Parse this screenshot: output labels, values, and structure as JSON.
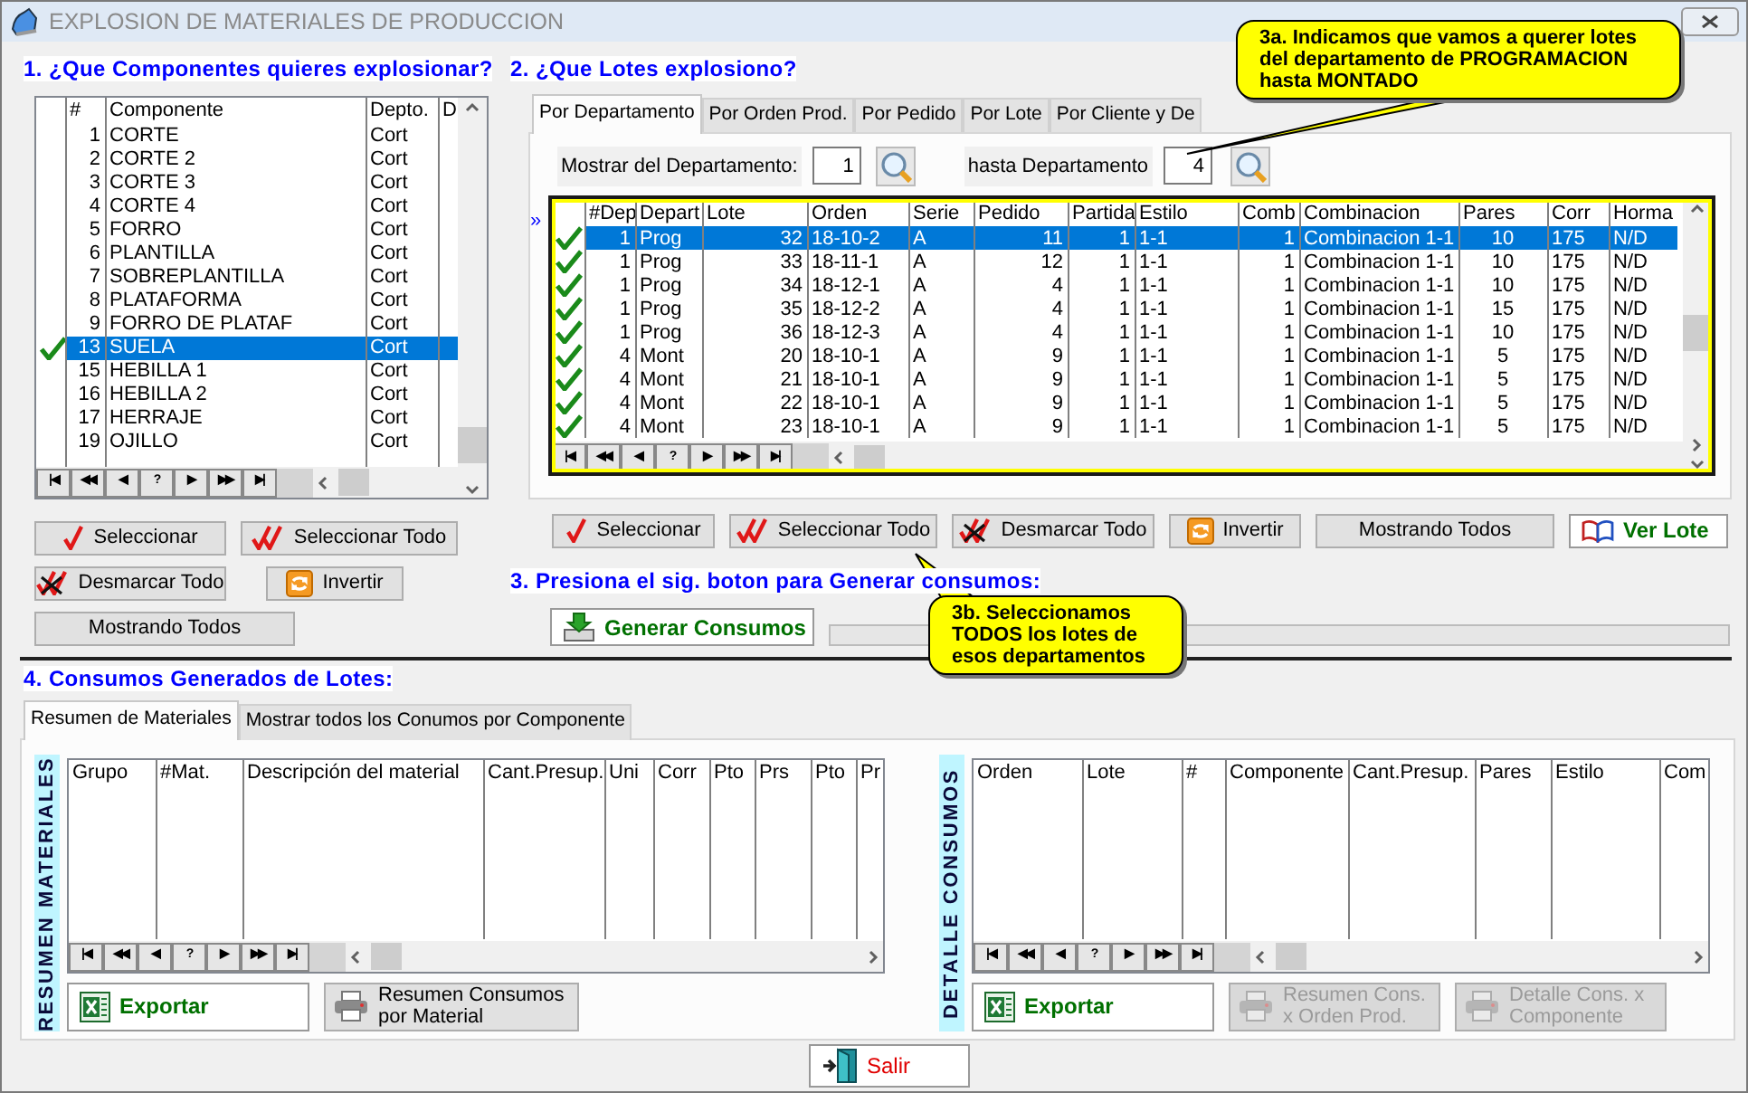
{
  "window": {
    "title": "EXPLOSION DE MATERIALES DE PRODUCCION"
  },
  "components": {
    "heading": "1. ¿Que Componentes quieres explosionar?",
    "grid": {
      "columns": [
        "#",
        "Componente",
        "Depto.",
        "D"
      ],
      "rows": [
        {
          "cells": [
            "1",
            "CORTE",
            "Cort"
          ],
          "checked": false,
          "selected": false
        },
        {
          "cells": [
            "2",
            "CORTE 2",
            "Cort"
          ],
          "checked": false,
          "selected": false
        },
        {
          "cells": [
            "3",
            "CORTE 3",
            "Cort"
          ],
          "checked": false,
          "selected": false
        },
        {
          "cells": [
            "4",
            "CORTE 4",
            "Cort"
          ],
          "checked": false,
          "selected": false
        },
        {
          "cells": [
            "5",
            "FORRO",
            "Cort"
          ],
          "checked": false,
          "selected": false
        },
        {
          "cells": [
            "6",
            "PLANTILLA",
            "Cort"
          ],
          "checked": false,
          "selected": false
        },
        {
          "cells": [
            "7",
            "SOBREPLANTILLA",
            "Cort"
          ],
          "checked": false,
          "selected": false
        },
        {
          "cells": [
            "8",
            "PLATAFORMA",
            "Cort"
          ],
          "checked": false,
          "selected": false
        },
        {
          "cells": [
            "9",
            "FORRO DE PLATAF",
            "Cort"
          ],
          "checked": false,
          "selected": false
        },
        {
          "cells": [
            "13",
            "SUELA",
            "Cort"
          ],
          "checked": true,
          "selected": true
        },
        {
          "cells": [
            "15",
            "HEBILLA 1",
            "Cort"
          ],
          "checked": false,
          "selected": false
        },
        {
          "cells": [
            "16",
            "HEBILLA 2",
            "Cort"
          ],
          "checked": false,
          "selected": false
        },
        {
          "cells": [
            "17",
            "HERRAJE",
            "Cort"
          ],
          "checked": false,
          "selected": false
        },
        {
          "cells": [
            "19",
            "OJILLO",
            "Cort"
          ],
          "checked": false,
          "selected": false
        }
      ],
      "navigator": [
        "|◀",
        "◀◀",
        "◀",
        "?",
        "▶",
        "▶▶",
        "▶|"
      ]
    },
    "buttons": [
      {
        "kind": "select",
        "label": "Seleccionar"
      },
      {
        "kind": "select-all",
        "label": "Seleccionar Todo"
      },
      {
        "kind": "unselect-all",
        "label": "Desmarcar Todo"
      },
      {
        "kind": "invert",
        "label": "Invertir"
      },
      {
        "kind": "show-all",
        "label": "Mostrando Todos"
      }
    ]
  },
  "lots": {
    "heading": "2. ¿Que Lotes explosiono?",
    "tabs": [
      {
        "label": "Por Departamento",
        "selected": true
      },
      {
        "label": "Por Orden Prod.",
        "selected": false
      },
      {
        "label": "Por Pedido",
        "selected": false
      },
      {
        "label": "Por Lote",
        "selected": false
      },
      {
        "label": "Por Cliente y De",
        "selected": false
      }
    ],
    "filter": {
      "from_label": "Mostrar del Departamento:",
      "from_value": "1",
      "to_label": "hasta Departamento",
      "to_value": "4"
    },
    "marker": "»",
    "grid": {
      "columns": [
        "#Dep",
        "Depart",
        "Lote",
        "Orden",
        "Serie",
        "Pedido",
        "Partida",
        "Estilo",
        "Comb",
        "Combinacion",
        "Pares",
        "Corr",
        "Horma"
      ],
      "rows": [
        {
          "cells": [
            "1",
            "Prog",
            "32",
            "18-10-2",
            "A",
            "11",
            "1",
            "1-1",
            "1",
            "Combinacion 1-1",
            "10",
            "175",
            "N/D"
          ],
          "checked": true,
          "selected": true
        },
        {
          "cells": [
            "1",
            "Prog",
            "33",
            "18-11-1",
            "A",
            "12",
            "1",
            "1-1",
            "1",
            "Combinacion 1-1",
            "10",
            "175",
            "N/D"
          ],
          "checked": true,
          "selected": false
        },
        {
          "cells": [
            "1",
            "Prog",
            "34",
            "18-12-1",
            "A",
            "4",
            "1",
            "1-1",
            "1",
            "Combinacion 1-1",
            "10",
            "175",
            "N/D"
          ],
          "checked": true,
          "selected": false
        },
        {
          "cells": [
            "1",
            "Prog",
            "35",
            "18-12-2",
            "A",
            "4",
            "1",
            "1-1",
            "1",
            "Combinacion 1-1",
            "15",
            "175",
            "N/D"
          ],
          "checked": true,
          "selected": false
        },
        {
          "cells": [
            "1",
            "Prog",
            "36",
            "18-12-3",
            "A",
            "4",
            "1",
            "1-1",
            "1",
            "Combinacion 1-1",
            "10",
            "175",
            "N/D"
          ],
          "checked": true,
          "selected": false
        },
        {
          "cells": [
            "4",
            "Mont",
            "20",
            "18-10-1",
            "A",
            "9",
            "1",
            "1-1",
            "1",
            "Combinacion 1-1",
            "5",
            "175",
            "N/D"
          ],
          "checked": true,
          "selected": false
        },
        {
          "cells": [
            "4",
            "Mont",
            "21",
            "18-10-1",
            "A",
            "9",
            "1",
            "1-1",
            "1",
            "Combinacion 1-1",
            "5",
            "175",
            "N/D"
          ],
          "checked": true,
          "selected": false
        },
        {
          "cells": [
            "4",
            "Mont",
            "22",
            "18-10-1",
            "A",
            "9",
            "1",
            "1-1",
            "1",
            "Combinacion 1-1",
            "5",
            "175",
            "N/D"
          ],
          "checked": true,
          "selected": false
        },
        {
          "cells": [
            "4",
            "Mont",
            "23",
            "18-10-1",
            "A",
            "9",
            "1",
            "1-1",
            "1",
            "Combinacion 1-1",
            "5",
            "175",
            "N/D"
          ],
          "checked": true,
          "selected": false
        }
      ],
      "navigator": [
        "|◀",
        "◀◀",
        "◀",
        "?",
        "▶",
        "▶▶",
        "▶|"
      ]
    },
    "buttons": [
      {
        "kind": "select",
        "label": "Seleccionar"
      },
      {
        "kind": "select-all",
        "label": "Seleccionar Todo"
      },
      {
        "kind": "unselect-all",
        "label": "Desmarcar Todo"
      },
      {
        "kind": "invert",
        "label": "Invertir"
      },
      {
        "kind": "show-all",
        "label": "Mostrando Todos"
      },
      {
        "kind": "view",
        "label": "Ver Lote"
      }
    ]
  },
  "generate": {
    "heading": "3. Presiona el sig. boton para Generar consumos:",
    "button": {
      "kind": "generate",
      "label": "Generar Consumos"
    },
    "progress": {
      "level": 0
    }
  },
  "results": {
    "heading": "4. Consumos Generados de Lotes:",
    "tabs": [
      {
        "label": "Resumen de Materiales",
        "selected": true
      },
      {
        "label": "Mostrar todos los Conumos por Componente",
        "selected": false
      }
    ],
    "summary": {
      "caption": "RESUMEN MATERIALES",
      "grid": {
        "columns": [
          "Grupo",
          "#Mat.",
          "Descripción del material",
          "Cant.Presup.",
          "Uni",
          "Corr",
          "Pto",
          "Prs",
          "Pto",
          "Pr"
        ],
        "navigator": [
          "|◀",
          "◀◀",
          "◀",
          "?",
          "▶",
          "▶▶",
          "▶|"
        ]
      },
      "buttons": [
        {
          "kind": "export",
          "label": "Exportar",
          "disabled": false
        },
        {
          "kind": "print",
          "label": "Resumen Consumos por Material",
          "disabled": false
        }
      ]
    },
    "detail": {
      "caption": "DETALLE CONSUMOS",
      "grid": {
        "columns": [
          "Orden",
          "Lote",
          "#",
          "Componente",
          "Cant.Presup.",
          "Pares",
          "Estilo",
          "Com"
        ],
        "navigator": [
          "|◀",
          "◀◀",
          "◀",
          "?",
          "▶",
          "▶▶",
          "▶|"
        ]
      },
      "buttons": [
        {
          "kind": "export",
          "label": "Exportar",
          "disabled": false
        },
        {
          "kind": "print",
          "label": "Resumen Cons. x Orden Prod.",
          "disabled": true
        },
        {
          "kind": "print",
          "label": "Detalle Cons. x Componente",
          "disabled": true
        }
      ]
    }
  },
  "exit_button": {
    "kind": "exit",
    "label": "Salir"
  },
  "callouts": [
    {
      "text": "3a. Indicamos que vamos a querer lotes del departamento de PROGRAMACION hasta MONTADO"
    },
    {
      "text": "3b. Seleccionamos TODOS los lotes de esos departamentos"
    }
  ]
}
